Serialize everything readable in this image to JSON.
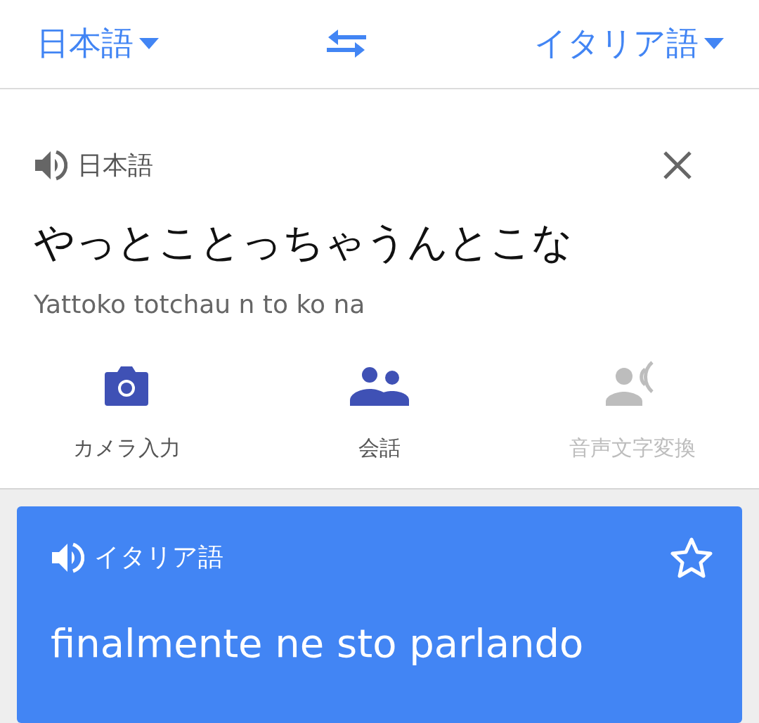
{
  "header": {
    "source_language": {
      "label": "日本語"
    },
    "target_language": {
      "label": "イタリア語"
    }
  },
  "input": {
    "language": "日本語",
    "text": "やっとことっちゃうんとこな",
    "romanization": "Yattoko totchau n to ko na",
    "actions": [
      {
        "label": "カメラ入力",
        "kind": "camera",
        "disabled": false
      },
      {
        "label": "会話",
        "kind": "conversation",
        "disabled": false
      },
      {
        "label": "音声文字変換",
        "kind": "transcribe",
        "disabled": true
      }
    ]
  },
  "result": {
    "language": "イタリア語",
    "text": "finalmente ne sto parlando",
    "starred": false
  }
}
